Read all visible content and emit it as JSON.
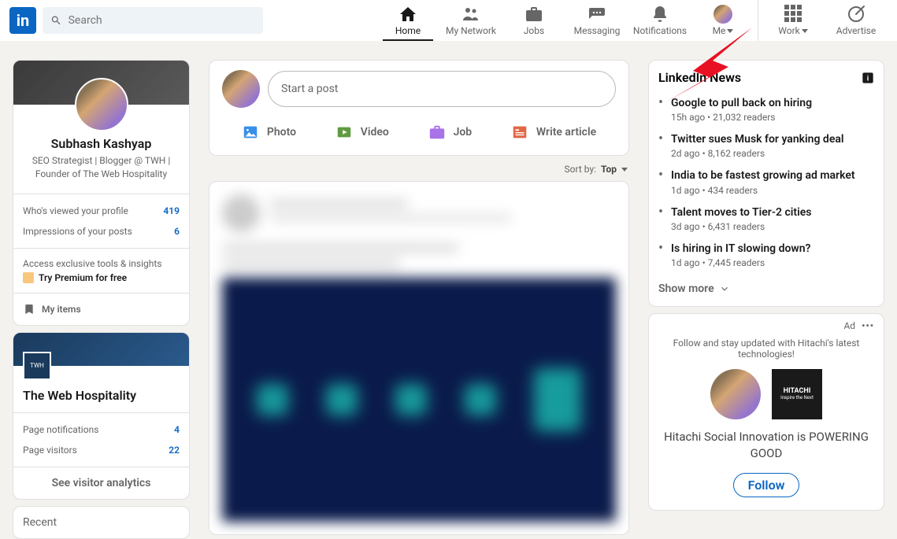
{
  "header": {
    "search_placeholder": "Search",
    "nav": [
      {
        "label": "Home",
        "active": true
      },
      {
        "label": "My Network"
      },
      {
        "label": "Jobs"
      },
      {
        "label": "Messaging"
      },
      {
        "label": "Notifications"
      },
      {
        "label": "Me"
      },
      {
        "label": "Work"
      },
      {
        "label": "Advertise"
      }
    ]
  },
  "profile": {
    "name": "Subhash Kashyap",
    "headline": "SEO Strategist | Blogger @ TWH | Founder of The Web Hospitality",
    "stats": [
      {
        "label": "Who's viewed your profile",
        "value": "419"
      },
      {
        "label": "Impressions of your posts",
        "value": "6"
      }
    ],
    "premium_intro": "Access exclusive tools & insights",
    "premium_cta": "Try Premium for free",
    "my_items": "My items"
  },
  "page": {
    "name": "The Web Hospitality",
    "stats": [
      {
        "label": "Page notifications",
        "value": "4"
      },
      {
        "label": "Page visitors",
        "value": "22"
      }
    ],
    "analytics": "See visitor analytics"
  },
  "recent_label": "Recent",
  "post": {
    "placeholder": "Start a post",
    "actions": [
      {
        "label": "Photo",
        "color": "#378fe9"
      },
      {
        "label": "Video",
        "color": "#5f9b41"
      },
      {
        "label": "Job",
        "color": "#a872e8"
      },
      {
        "label": "Write article",
        "color": "#e16745"
      }
    ]
  },
  "sort": {
    "prefix": "Sort by:",
    "value": "Top"
  },
  "news": {
    "title": "LinkedIn News",
    "items": [
      {
        "title": "Google to pull back on hiring",
        "meta": "15h ago • 21,032 readers"
      },
      {
        "title": "Twitter sues Musk for yanking deal",
        "meta": "2d ago • 8,162 readers"
      },
      {
        "title": "India to be fastest growing ad market",
        "meta": "1d ago • 434 readers"
      },
      {
        "title": "Talent moves to Tier-2 cities",
        "meta": "3d ago • 6,431 readers"
      },
      {
        "title": "Is hiring in IT slowing down?",
        "meta": "1d ago • 7,445 readers"
      }
    ],
    "show_more": "Show more"
  },
  "ad": {
    "badge": "Ad",
    "sub": "Follow and stay updated with Hitachi's latest technologies!",
    "brand_top": "HITACHI",
    "brand_bottom": "Inspire the Next",
    "text": "Hitachi Social Innovation is POWERING GOOD",
    "cta": "Follow"
  }
}
